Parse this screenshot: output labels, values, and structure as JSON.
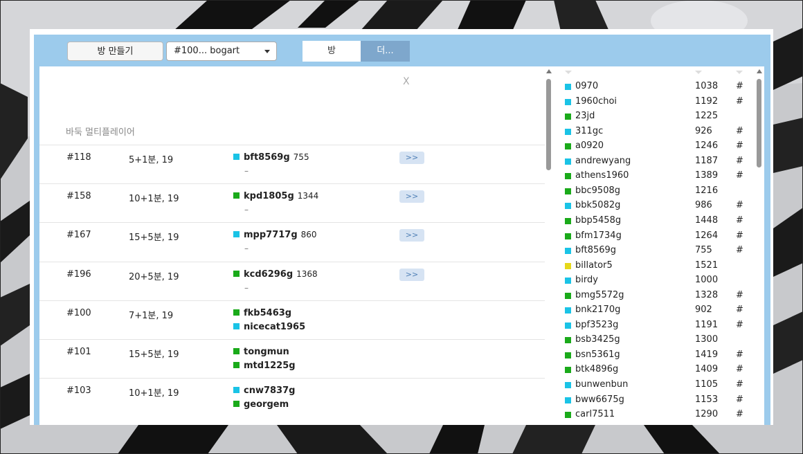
{
  "colors": {
    "cyan": "#1ac3e6",
    "green": "#1aaa1a",
    "yellow": "#e6d81a",
    "panel_blue": "#9ccbec",
    "tab_active": "#7ea7cc"
  },
  "toolbar": {
    "create_room_label": "방 만들기",
    "room_select_value": "#100... bogart",
    "tab_room_label": "방",
    "tab_more_label": "더..."
  },
  "main": {
    "close_label": "X",
    "section_title": "바둑 멀티플레이어",
    "rooms": [
      {
        "id": "#118",
        "time": "5+1분, 19",
        "players": [
          {
            "name": "bft8569g",
            "rating": "755",
            "color": "cyan"
          }
        ],
        "waiting": true,
        "join_label": ">>"
      },
      {
        "id": "#158",
        "time": "10+1분, 19",
        "players": [
          {
            "name": "kpd1805g",
            "rating": "1344",
            "color": "green"
          }
        ],
        "waiting": true,
        "join_label": ">>"
      },
      {
        "id": "#167",
        "time": "15+5분, 19",
        "players": [
          {
            "name": "mpp7717g",
            "rating": "860",
            "color": "cyan"
          }
        ],
        "waiting": true,
        "join_label": ">>"
      },
      {
        "id": "#196",
        "time": "20+5분, 19",
        "players": [
          {
            "name": "kcd6296g",
            "rating": "1368",
            "color": "green"
          }
        ],
        "waiting": true,
        "join_label": ">>"
      },
      {
        "id": "#100",
        "time": "7+1분, 19",
        "players": [
          {
            "name": "fkb5463g",
            "rating": "",
            "color": "green"
          },
          {
            "name": "nicecat1965",
            "rating": "",
            "color": "cyan"
          }
        ],
        "waiting": false
      },
      {
        "id": "#101",
        "time": "15+5분, 19",
        "players": [
          {
            "name": "tongmun",
            "rating": "",
            "color": "green"
          },
          {
            "name": "mtd1225g",
            "rating": "",
            "color": "green"
          }
        ],
        "waiting": false
      },
      {
        "id": "#103",
        "time": "10+1분, 19",
        "players": [
          {
            "name": "cnw7837g",
            "rating": "",
            "color": "cyan"
          },
          {
            "name": "georgem",
            "rating": "",
            "color": "green"
          }
        ],
        "waiting": false
      }
    ],
    "waiting_dash": "–"
  },
  "users": [
    {
      "name": "0970",
      "rating": "1038",
      "hash": "#",
      "color": "cyan"
    },
    {
      "name": "1960choi",
      "rating": "1192",
      "hash": "#",
      "color": "cyan"
    },
    {
      "name": "23jd",
      "rating": "1225",
      "hash": "",
      "color": "green"
    },
    {
      "name": "311gc",
      "rating": "926",
      "hash": "#",
      "color": "cyan"
    },
    {
      "name": "a0920",
      "rating": "1246",
      "hash": "#",
      "color": "green"
    },
    {
      "name": "andrewyang",
      "rating": "1187",
      "hash": "#",
      "color": "cyan"
    },
    {
      "name": "athens1960",
      "rating": "1389",
      "hash": "#",
      "color": "green"
    },
    {
      "name": "bbc9508g",
      "rating": "1216",
      "hash": "",
      "color": "green"
    },
    {
      "name": "bbk5082g",
      "rating": "986",
      "hash": "#",
      "color": "cyan"
    },
    {
      "name": "bbp5458g",
      "rating": "1448",
      "hash": "#",
      "color": "green"
    },
    {
      "name": "bfm1734g",
      "rating": "1264",
      "hash": "#",
      "color": "green"
    },
    {
      "name": "bft8569g",
      "rating": "755",
      "hash": "#",
      "color": "cyan"
    },
    {
      "name": "billator5",
      "rating": "1521",
      "hash": "",
      "color": "yellow"
    },
    {
      "name": "birdy",
      "rating": "1000",
      "hash": "",
      "color": "cyan"
    },
    {
      "name": "bmg5572g",
      "rating": "1328",
      "hash": "#",
      "color": "green"
    },
    {
      "name": "bnk2170g",
      "rating": "902",
      "hash": "#",
      "color": "cyan"
    },
    {
      "name": "bpf3523g",
      "rating": "1191",
      "hash": "#",
      "color": "cyan"
    },
    {
      "name": "bsb3425g",
      "rating": "1300",
      "hash": "",
      "color": "green"
    },
    {
      "name": "bsn5361g",
      "rating": "1419",
      "hash": "#",
      "color": "green"
    },
    {
      "name": "btk4896g",
      "rating": "1409",
      "hash": "#",
      "color": "green"
    },
    {
      "name": "bunwenbun",
      "rating": "1105",
      "hash": "#",
      "color": "cyan"
    },
    {
      "name": "bww6675g",
      "rating": "1153",
      "hash": "#",
      "color": "cyan"
    },
    {
      "name": "carl7511",
      "rating": "1290",
      "hash": "#",
      "color": "green"
    }
  ]
}
